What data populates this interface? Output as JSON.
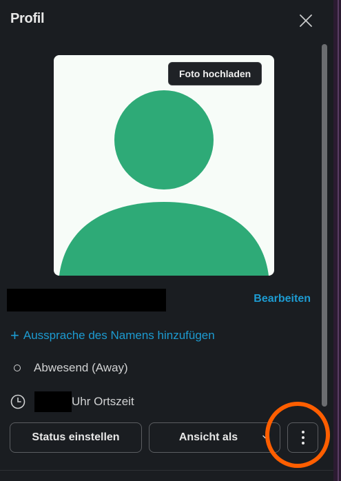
{
  "panel": {
    "title": "Profil",
    "close_icon": "close-icon"
  },
  "avatar": {
    "upload_label": "Foto hochladen",
    "placeholder_color": "#2eaa77"
  },
  "profile": {
    "edit_label": "Bearbeiten",
    "pronounce_plus": "+",
    "pronounce_label": "Aussprache des Namens hinzufügen",
    "status_label": "Abwesend (Away)",
    "local_time_suffix": "Uhr Ortszeit"
  },
  "actions": {
    "set_status_label": "Status einstellen",
    "view_as_label": "Ansicht als",
    "more_icon": "vertical-ellipsis-icon"
  },
  "colors": {
    "link": "#1d9bd1",
    "highlight": "#ff5e00",
    "background": "#1a1d21"
  }
}
